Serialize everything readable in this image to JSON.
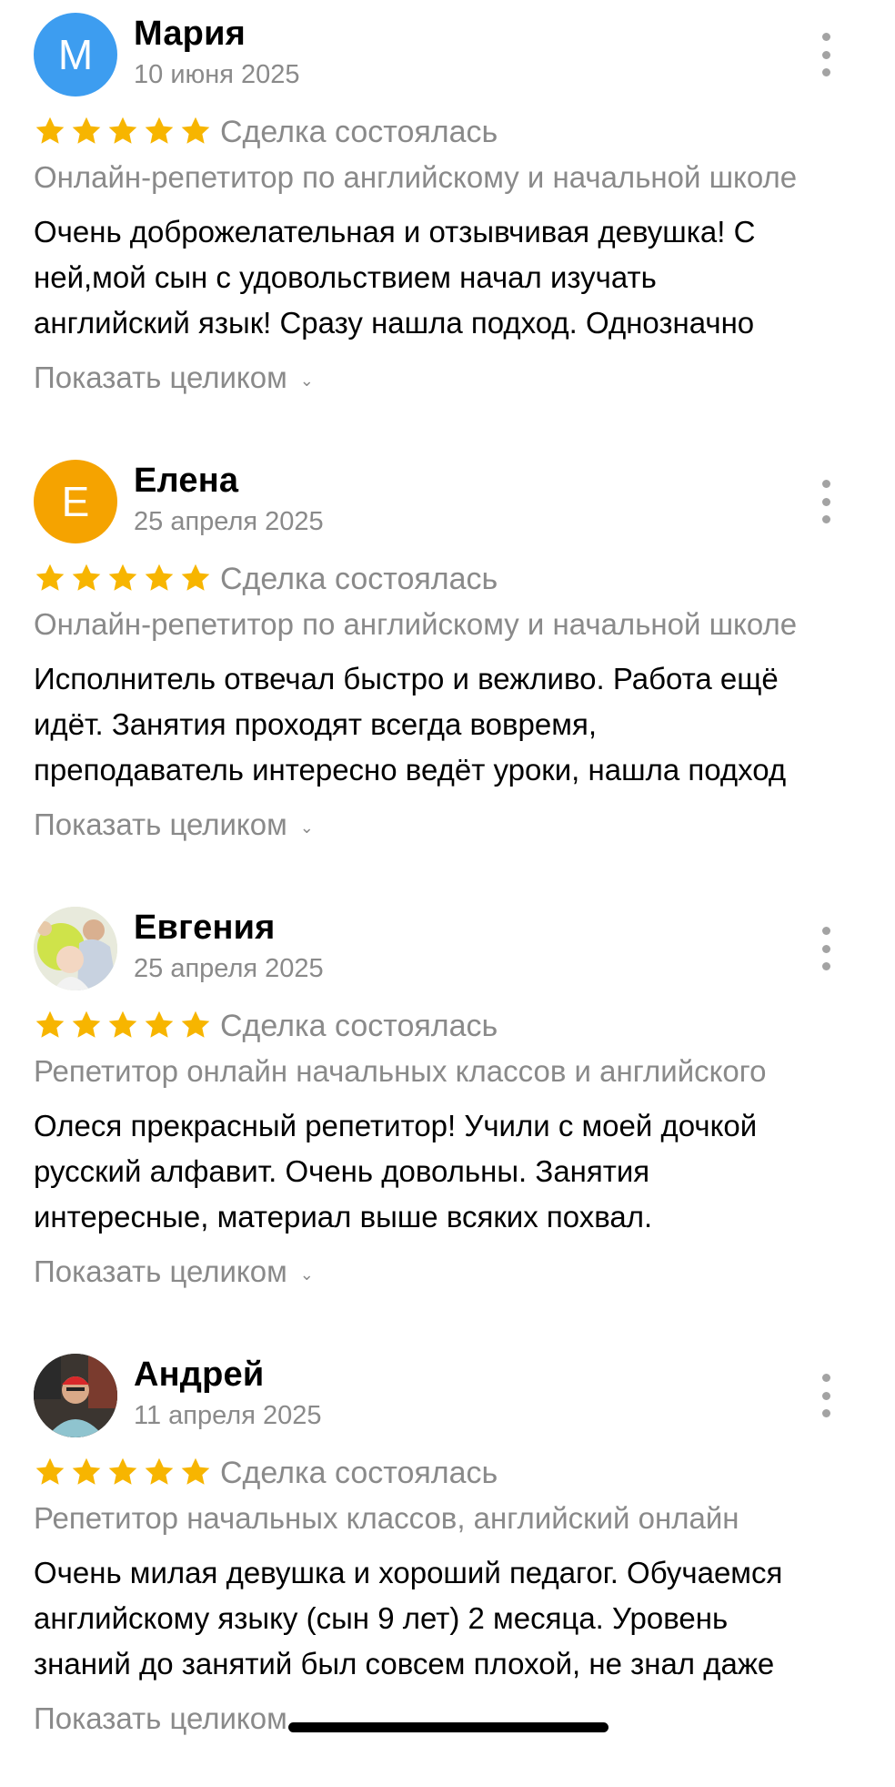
{
  "colors": {
    "star": "#f7b500",
    "muted_text": "#8a8a8a",
    "menu_dots": "#a3a3a3",
    "avatar_maria": "#3d9df0",
    "avatar_elena": "#f5a300"
  },
  "show_more_label": "Показать целиком",
  "deal_label": "Сделка состоялась",
  "reviews": [
    {
      "author": "Мария",
      "initial": "М",
      "avatar_type": "letter",
      "date": "10 июня 2025",
      "rating": 5,
      "service": "Онлайн-репетитор по английскому и начальной школе",
      "lines": [
        "Очень доброжелательная и отзывчивая девушка! С",
        "ней,мой сын с удовольствием начал изучать",
        "английский язык! Сразу нашла подход. Однозначно"
      ]
    },
    {
      "author": "Елена",
      "initial": "Е",
      "avatar_type": "letter",
      "date": "25 апреля 2025",
      "rating": 5,
      "service": "Онлайн-репетитор по английскому и начальной школе",
      "lines": [
        "Исполнитель отвечал быстро и вежливо. Работа ещё",
        "идёт. Занятия проходят всегда вовремя,",
        "преподаватель интересно ведёт уроки, нашла подход"
      ]
    },
    {
      "author": "Евгения",
      "avatar_type": "photo",
      "date": "25 апреля 2025",
      "rating": 5,
      "service": "Репетитор онлайн начальных классов и английского",
      "lines": [
        "Олеся прекрасный репетитор! Учили с моей дочкой",
        "русский алфавит. Очень довольны. Занятия",
        "интересные, материал выше всяких похвал."
      ]
    },
    {
      "author": "Андрей",
      "avatar_type": "photo",
      "date": "11 апреля 2025",
      "rating": 5,
      "service": "Репетитор начальных классов, английский онлайн",
      "lines": [
        "Очень милая девушка и хороший педагог. Обучаемся",
        "английскому языку (сын 9 лет) 2 месяца. Уровень",
        "знаний до занятий был совсем плохой, не знал даже"
      ]
    }
  ]
}
